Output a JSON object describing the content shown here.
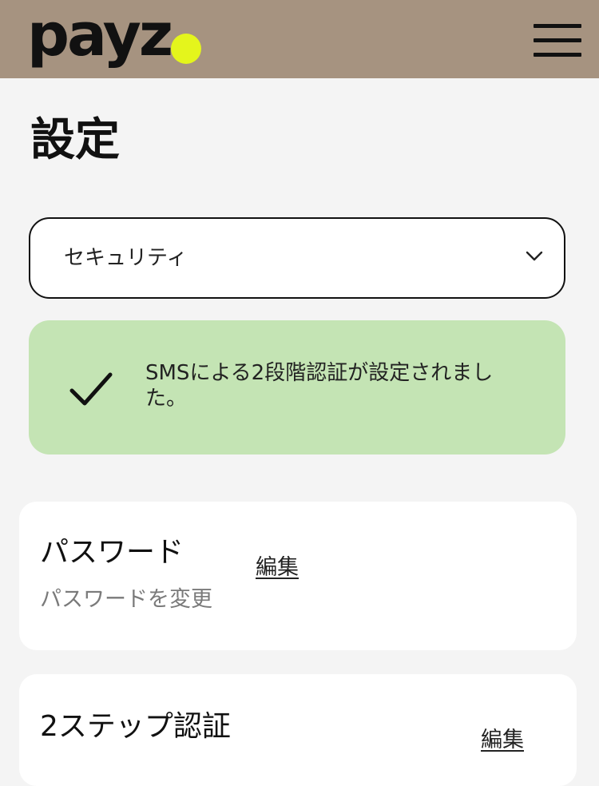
{
  "header": {
    "logo_text": "payz",
    "logo_dot_color": "#e4f51c",
    "menu_icon": "hamburger-menu-icon"
  },
  "page": {
    "title": "設定"
  },
  "category_select": {
    "value": "セキュリティ",
    "icon": "chevron-down-icon"
  },
  "alert": {
    "icon": "checkmark-icon",
    "message": "SMSによる2段階認証が設定されました。",
    "background_color": "#c4e4b4"
  },
  "settings": {
    "password": {
      "title": "パスワード",
      "subtitle": "パスワードを変更",
      "edit_label": "編集"
    },
    "two_step": {
      "title": "2ステップ認証",
      "edit_label": "編集"
    }
  }
}
